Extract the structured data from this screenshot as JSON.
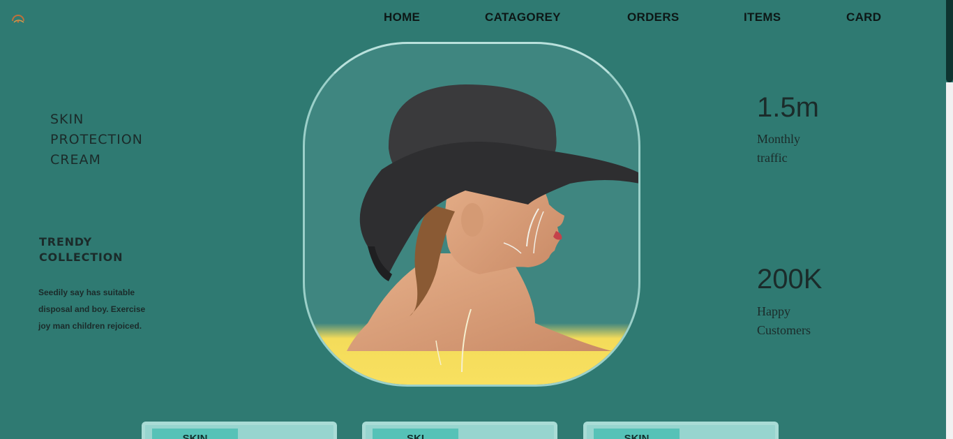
{
  "nav": {
    "items": [
      "HOME",
      "CATAGOREY",
      "ORDERS",
      "ITEMS",
      "CARD"
    ]
  },
  "hero": {
    "title_lines": [
      "SKIN",
      "PROTECTION",
      "CREAM"
    ]
  },
  "trendy": {
    "title_lines": [
      "TRENDY",
      "COLLECTION"
    ],
    "description": "Seedily say has suitable disposal and boy. Exercise joy man children rejoiced."
  },
  "stats": [
    {
      "value": "1.5m",
      "label_lines": [
        "Monthly",
        "traffic"
      ]
    },
    {
      "value": "200K",
      "label_lines": [
        "Happy",
        "Customers"
      ]
    }
  ],
  "cards": [
    {
      "tag": "SKIN"
    },
    {
      "tag": "SKI"
    },
    {
      "tag": "SKIN"
    }
  ],
  "colors": {
    "background": "#2f7a72",
    "frame_border": "#9bd0c9",
    "card_bg": "#97d5cf",
    "card_tag": "#56c2b7",
    "hat": "#3a3a3c",
    "shirt": "#f4dc5a"
  },
  "icons": {
    "logo": "logo-icon",
    "hero_image": "woman-in-hat-image"
  }
}
